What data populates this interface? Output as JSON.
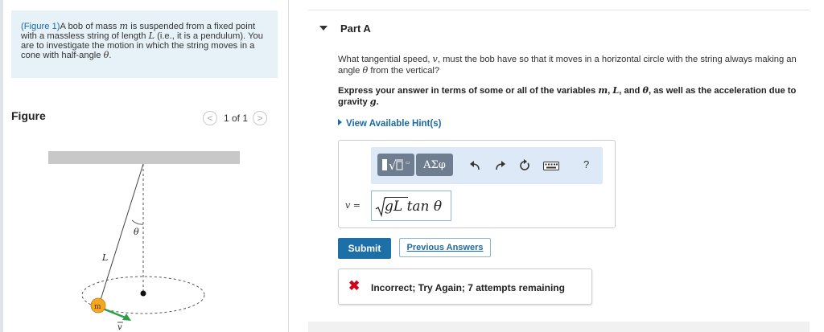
{
  "left": {
    "intro": {
      "fig_link": "(Figure 1)",
      "t1": "A bob of mass ",
      "m": "m",
      "t2": " is suspended from a fixed point with a massless string of length ",
      "L": "L",
      "t3": " (i.e., it is a pendulum). You are to investigate the motion in which the string moves in a cone with half-angle ",
      "theta": "θ",
      "t4": "."
    },
    "figure_title": "Figure",
    "pager": {
      "prev": "<",
      "count": "1 of 1",
      "next": ">"
    },
    "diagram": {
      "theta": "θ",
      "L": "L",
      "m": "m",
      "v": "v"
    }
  },
  "part": {
    "title": "Part A",
    "question": {
      "t1": "What tangential speed, ",
      "v": "v",
      "t2": ", must the bob have so that it moves in a horizontal circle with the string always making an angle ",
      "theta": "θ",
      "t3": " from the vertical?"
    },
    "instruction": {
      "t1": "Express your answer in terms of some or all of the variables ",
      "m": "m",
      "sep1": ", ",
      "L": "L",
      "sep2": ", and ",
      "theta": "θ",
      "t2": ", as well as the acceleration due to gravity ",
      "g": "g",
      "t3": "."
    },
    "hint_link": "View Available Hint(s)",
    "toolbar": {
      "greek_label": "ΑΣφ",
      "help_label": "?"
    },
    "variable_label": "v =",
    "answer": {
      "radicand": "gL tan ",
      "theta": "θ"
    },
    "submit_label": "Submit",
    "previous_answers_label": "Previous Answers",
    "feedback": {
      "icon": "✖",
      "message": "Incorrect; Try Again; 7 attempts remaining"
    }
  },
  "colors": {
    "accent_blue": "#1d6fa8",
    "link_blue": "#1a6aa5",
    "error_red": "#d0021b",
    "intro_bg": "#e7f2f8",
    "toolbar_bg": "#dde9f6",
    "bob_orange": "#f5a623",
    "velocity_green": "#2e9e4b"
  }
}
